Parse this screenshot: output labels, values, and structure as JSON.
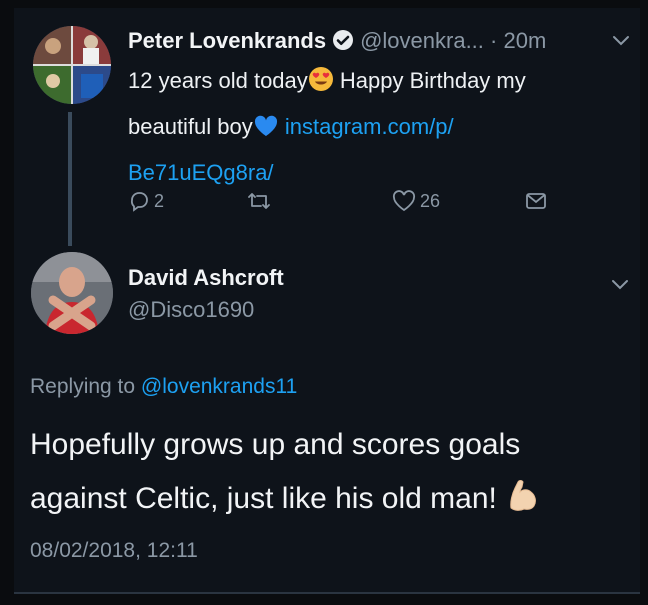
{
  "tweet": {
    "author_name": "Peter Lovenkrands",
    "author_handle": "@lovenkra...",
    "time": "· 20m",
    "text_1": "12 years old today",
    "text_2": " Happy Birthday my beautiful boy",
    "link": "instagram.com/p/ Be71uEQg8ra/",
    "reply_count": "2",
    "like_count": "26",
    "icons": [
      "verified-icon",
      "chevron-down-icon",
      "reply-icon",
      "retweet-icon",
      "like-icon",
      "message-icon",
      "heart-eyes-emoji",
      "blue-heart-emoji"
    ]
  },
  "reply": {
    "author_name": "David Ashcroft",
    "author_handle": "@Disco1690",
    "replying_prefix": "Replying to ",
    "replying_handle": "@lovenkrands11",
    "text": "Hopefully grows up and scores goals against Celtic, just like his old man!",
    "timestamp": "08/02/2018, 12:11",
    "icons": [
      "chevron-down-icon",
      "flexed-biceps-emoji"
    ]
  },
  "colors": {
    "background": "#0e131a",
    "link": "#1da1f2",
    "muted": "#8b98a5",
    "verified": "#1da1f2"
  }
}
